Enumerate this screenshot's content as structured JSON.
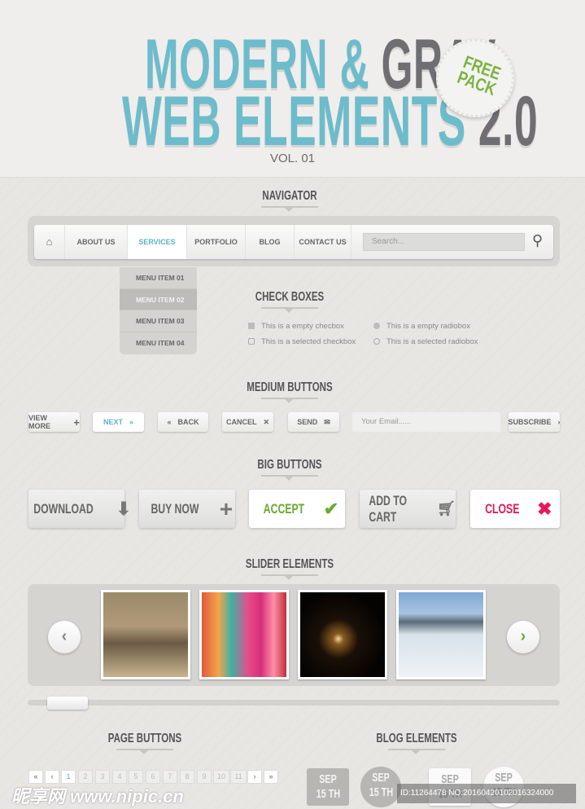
{
  "header": {
    "title_line1_a": "MODERN &",
    "title_line1_b": "GRAY",
    "title_line2_a": "WEB ELEMENTS",
    "title_line2_b": "2.0",
    "subtitle": "VOL. 01",
    "badge": "FREE PACK",
    "accent": "#6dbccb",
    "gray": "#6e6e73"
  },
  "sections": {
    "navigator": "NAVIGATOR",
    "checkboxes": "CHECK BOXES",
    "medium": "MEDIUM BUTTONS",
    "big": "BIG BUTTONS",
    "slider": "SLIDER ELEMENTS",
    "page": "PAGE BUTTONS",
    "blog": "BLOG ELEMENTS"
  },
  "nav": {
    "home_icon": "home-icon",
    "items": [
      "ABOUT US",
      "SERVICES",
      "PORTFOLIO",
      "BLOG",
      "CONTACT US"
    ],
    "active": "SERVICES",
    "search_placeholder": "Search...",
    "dropdown": [
      "MENU ITEM 01",
      "MENU ITEM 02",
      "MENU ITEM 03",
      "MENU ITEM 04"
    ],
    "dropdown_selected": "MENU ITEM 02"
  },
  "checks": {
    "empty_checkbox": "This is a empty checbox",
    "selected_checkbox": "This is a selected checkbox",
    "empty_radio": "This is a empty radiobox",
    "selected_radio": "This is a selected radiobox"
  },
  "medium": {
    "view_more": "VIEW MORE",
    "next": "NEXT",
    "back": "BACK",
    "cancel": "CANCEL",
    "send": "SEND",
    "email_placeholder": "Your Email......",
    "subscribe": "SUBSCRIBE"
  },
  "big": {
    "download": "DOWNLOAD",
    "buy_now": "BUY NOW",
    "accept": "ACCEPT",
    "add_to_cart": "ADD TO CART",
    "close": "CLOSE",
    "accept_color": "#6aaa2e",
    "close_color": "#e8195a"
  },
  "slider": {
    "prev": "‹",
    "next": "›",
    "images": [
      "dirt-bike",
      "colorful-braids",
      "star-cluster",
      "frozen-lake"
    ],
    "position": 0.05
  },
  "pages": {
    "first": "«",
    "prev": "‹",
    "numbers": [
      "1",
      "2",
      "3",
      "4",
      "5",
      "6",
      "7",
      "8",
      "9",
      "10",
      "11"
    ],
    "current": "1",
    "next": "›",
    "last": "»"
  },
  "blog": {
    "month": "SEP",
    "day": "15 TH"
  },
  "watermark": {
    "logo": "昵享网 www.nipic.cn",
    "id": "ID:11264478 NO:20160420102016324000"
  }
}
